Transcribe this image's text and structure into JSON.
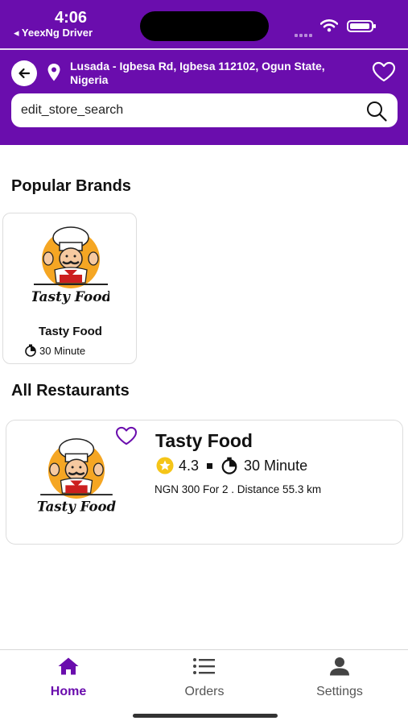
{
  "status_bar": {
    "time": "4:06",
    "back_app": "◂ YeexNg Driver"
  },
  "header": {
    "address": "Lusada - Igbesa Rd, Igbesa 112102, Ogun State, Nigeria",
    "search_value": "edit_store_search"
  },
  "popular_brands": {
    "title": "Popular Brands",
    "items": [
      {
        "name": "Tasty Food",
        "time": "30 Minute",
        "logo_text": "Tasty Food"
      }
    ]
  },
  "all_restaurants": {
    "title": "All Restaurants",
    "items": [
      {
        "name": "Tasty Food",
        "rating": "4.3",
        "time": "30 Minute",
        "info": "NGN 300 For 2 . Distance 55.3 km",
        "logo_text": "Tasty Food"
      }
    ]
  },
  "bottom_nav": {
    "items": [
      {
        "label": "Home",
        "icon": "home-icon",
        "active": true
      },
      {
        "label": "Orders",
        "icon": "list-icon",
        "active": false
      },
      {
        "label": "Settings",
        "icon": "person-icon",
        "active": false
      }
    ]
  },
  "colors": {
    "brand": "#6a0dad",
    "rating_star": "#f5c518"
  }
}
